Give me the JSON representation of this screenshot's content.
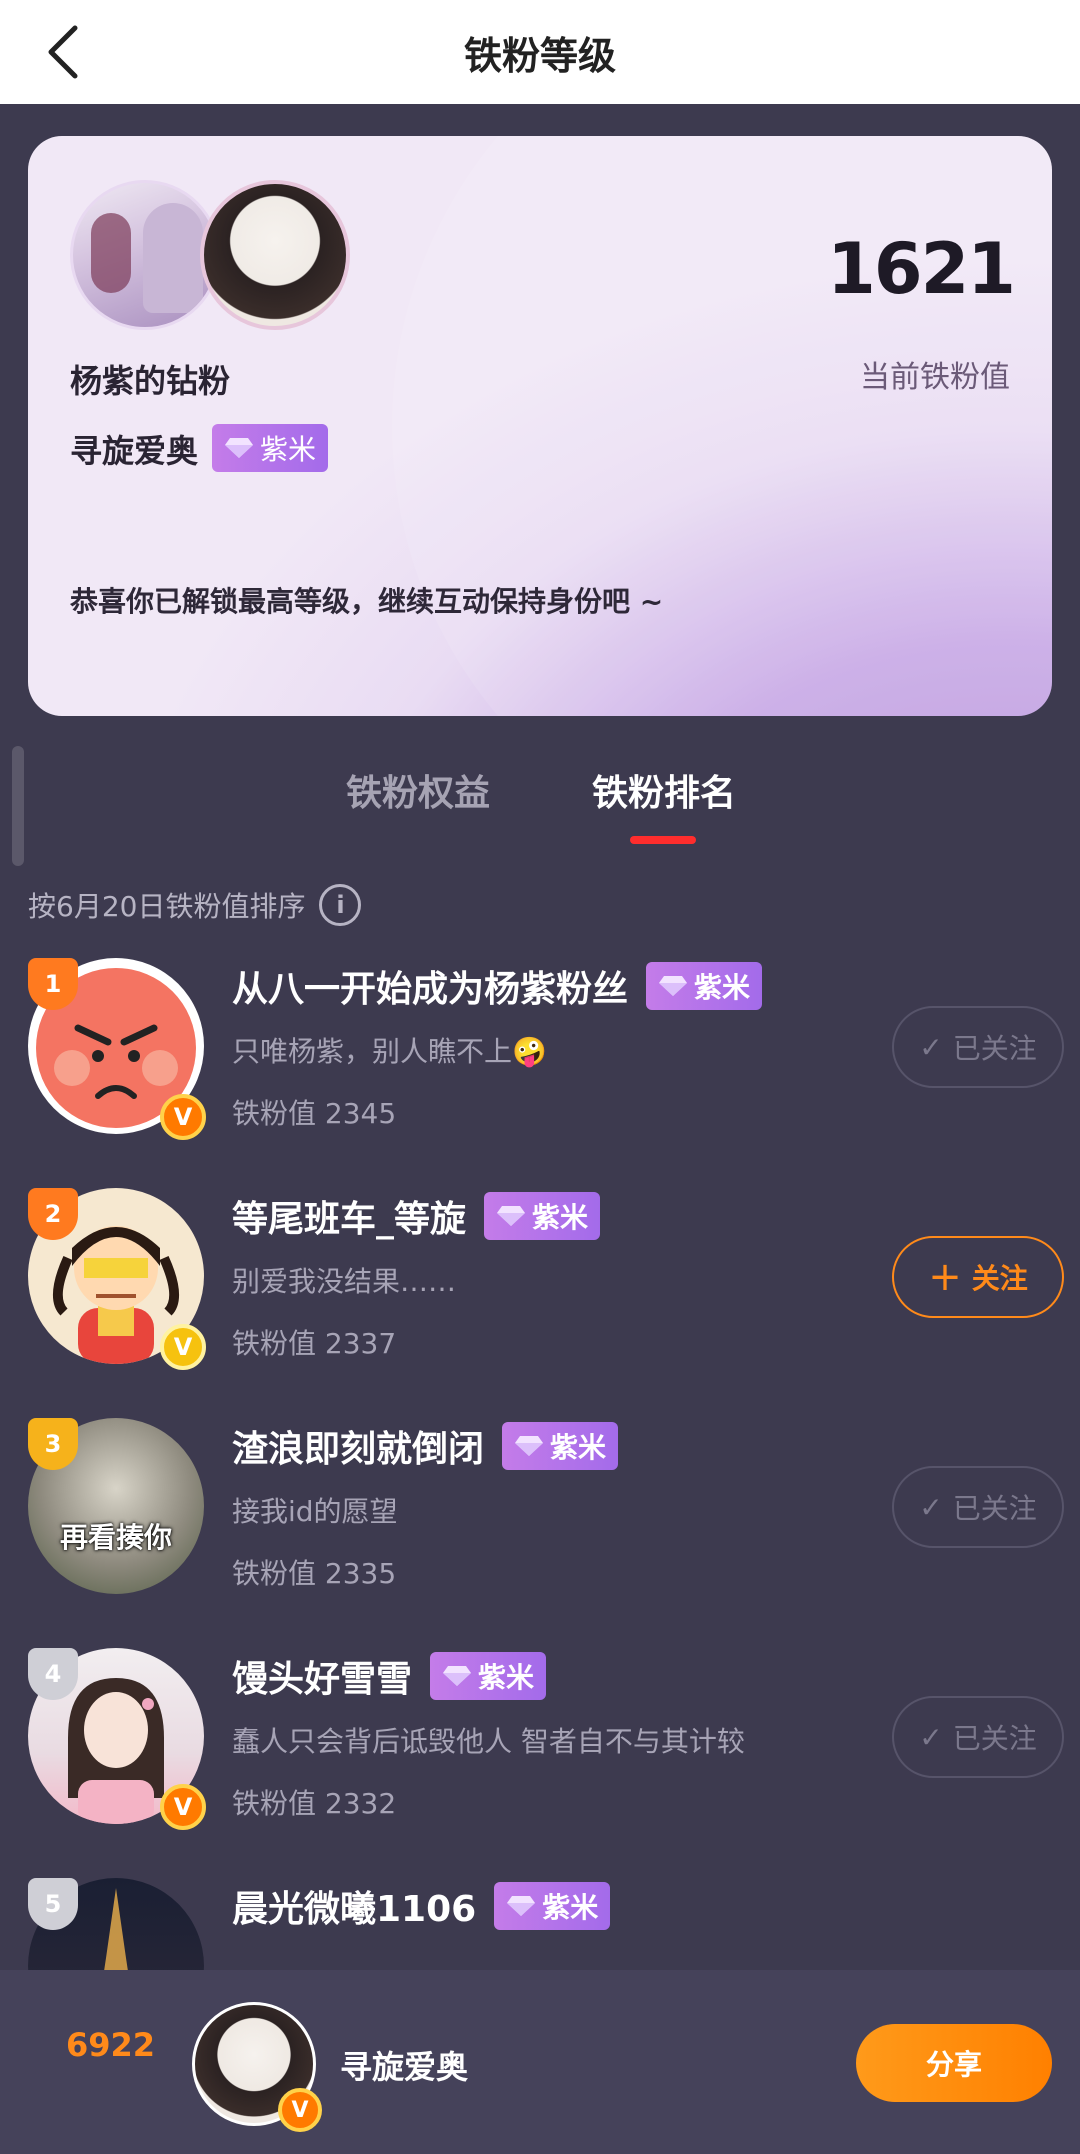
{
  "header": {
    "title": "铁粉等级"
  },
  "card": {
    "fan_group": "杨紫的钻粉",
    "username": "寻旋爱奥",
    "badge": "紫米",
    "score": "1621",
    "score_label": "当前铁粉值",
    "message": "恭喜你已解锁最高等级，继续互动保持身份吧 ~"
  },
  "tabs": [
    {
      "label": "铁粉权益",
      "active": false
    },
    {
      "label": "铁粉排名",
      "active": true
    }
  ],
  "sort_text": "按6月20日铁粉值排序",
  "ranking": [
    {
      "rank": "1",
      "name": "从八一开始成为杨紫粉丝",
      "badge": "紫米",
      "bio": "只唯杨紫，别人瞧不上🤪",
      "value_label": "铁粉值",
      "value": "2345",
      "button": "已关注",
      "followed": true
    },
    {
      "rank": "2",
      "name": "等尾班车_等旋",
      "badge": "紫米",
      "bio": "别爱我没结果……",
      "value_label": "铁粉值",
      "value": "2337",
      "button": "关注",
      "followed": false
    },
    {
      "rank": "3",
      "name": "渣浪即刻就倒闭",
      "badge": "紫米",
      "bio": "接我id的愿望",
      "value_label": "铁粉值",
      "value": "2335",
      "button": "已关注",
      "followed": true,
      "avatar_text": "再看揍你"
    },
    {
      "rank": "4",
      "name": "馒头好雪雪",
      "badge": "紫米",
      "bio": "蠢人只会背后诋毁他人 智者自不与其计较",
      "value_label": "铁粉值",
      "value": "2332",
      "button": "已关注",
      "followed": true
    },
    {
      "rank": "5",
      "name": "晨光微曦1106",
      "badge": "紫米"
    }
  ],
  "bottom": {
    "my_rank": "6922",
    "my_name": "寻旋爱奥",
    "share": "分享"
  },
  "colors": {
    "accent_orange": "#ff8a1a",
    "badge_purple": "#a36bea",
    "tab_underline": "#ff2d2d",
    "background": "#3d3a4f"
  }
}
